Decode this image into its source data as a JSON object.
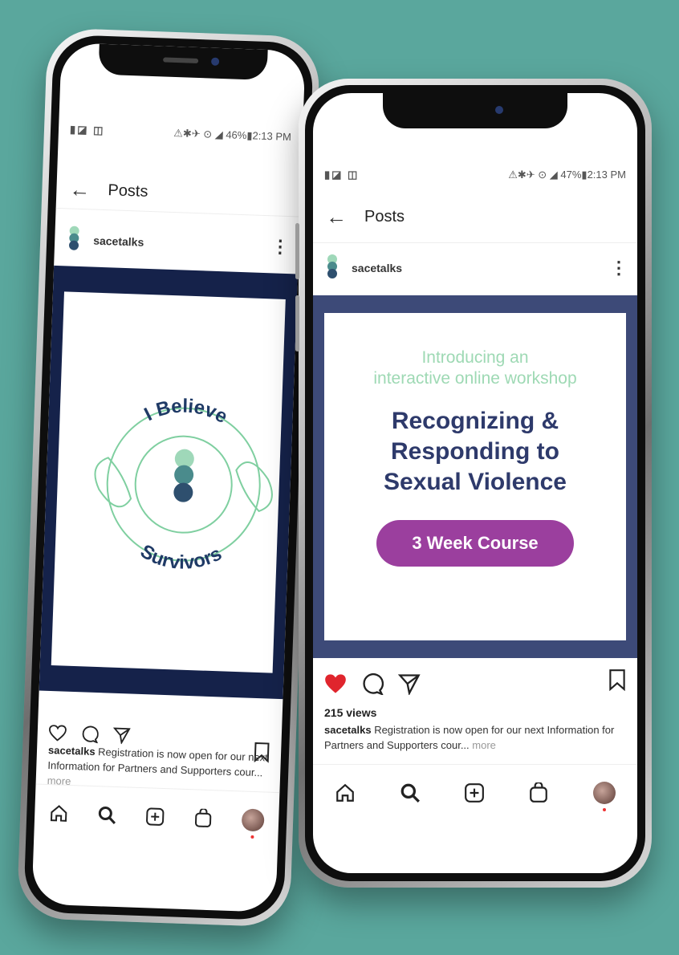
{
  "phones": [
    {
      "status": {
        "left": "▮◪ ◫",
        "right": "⚠✱✈ ⊙ ◢ 46%▮2:13 PM"
      },
      "header": {
        "title": "Posts"
      },
      "account": {
        "name": "sacetalks"
      },
      "post": {
        "top_text": "I Believe",
        "bottom_text": "Survivors"
      },
      "caption": {
        "user": "sacetalks",
        "text": "Registration is now open for our next Information for Partners and Supporters cour...",
        "more": "more"
      }
    },
    {
      "status": {
        "left": "▮◪ ◫",
        "right": "⚠✱✈ ⊙ ◢ 47%▮2:13 PM"
      },
      "header": {
        "title": "Posts"
      },
      "account": {
        "name": "sacetalks"
      },
      "post": {
        "intro_line1": "Introducing an",
        "intro_line2": "interactive online workshop",
        "headline_line1": "Recognizing &",
        "headline_line2": "Responding to",
        "headline_line3": "Sexual Violence",
        "cta": "3 Week Course"
      },
      "views": "215 views",
      "caption": {
        "user": "sacetalks",
        "text": "Registration is now open for our next Information for Partners and Supporters cour...",
        "more": "more"
      }
    }
  ],
  "colors": {
    "background": "#5aa79d",
    "navy": "#2e3a6b",
    "purple": "#9b3f9e",
    "mint": "#7fcfa0",
    "like": "#e0252d"
  }
}
